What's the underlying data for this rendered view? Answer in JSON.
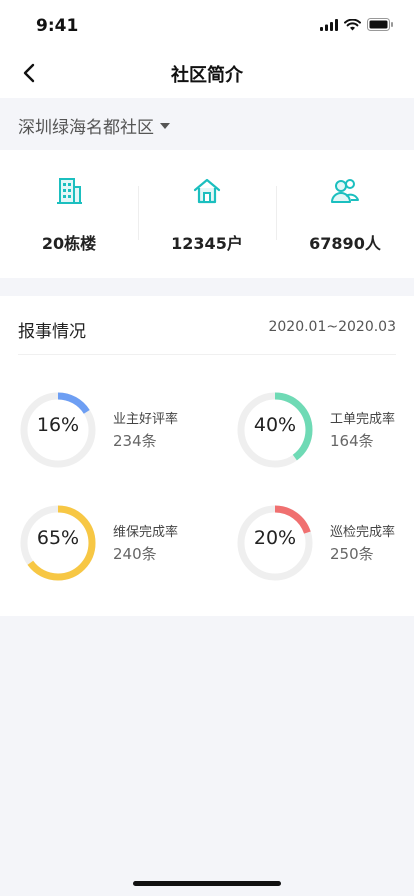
{
  "status_bar": {
    "time": "9:41"
  },
  "nav": {
    "title": "社区简介"
  },
  "community": {
    "selected": "深圳绿海名都社区"
  },
  "stats": [
    {
      "label": "20栋楼",
      "icon": "building-icon"
    },
    {
      "label": "12345户",
      "icon": "house-icon"
    },
    {
      "label": "67890人",
      "icon": "residents-icon"
    }
  ],
  "report": {
    "title": "报事情况",
    "range": "2020.01~2020.03",
    "metrics": [
      {
        "percent_label": "16%",
        "percent": 16,
        "label": "业主好评率",
        "count": "234条",
        "color": "#6d9ef3"
      },
      {
        "percent_label": "40%",
        "percent": 40,
        "label": "工单完成率",
        "count": "164条",
        "color": "#6fdab5"
      },
      {
        "percent_label": "65%",
        "percent": 65,
        "label": "维保完成率",
        "count": "240条",
        "color": "#f7c744"
      },
      {
        "percent_label": "20%",
        "percent": 20,
        "label": "巡检完成率",
        "count": "250条",
        "color": "#f07070"
      }
    ]
  },
  "colors": {
    "accent": "#1bbfbf",
    "ring_track": "#efefef"
  }
}
